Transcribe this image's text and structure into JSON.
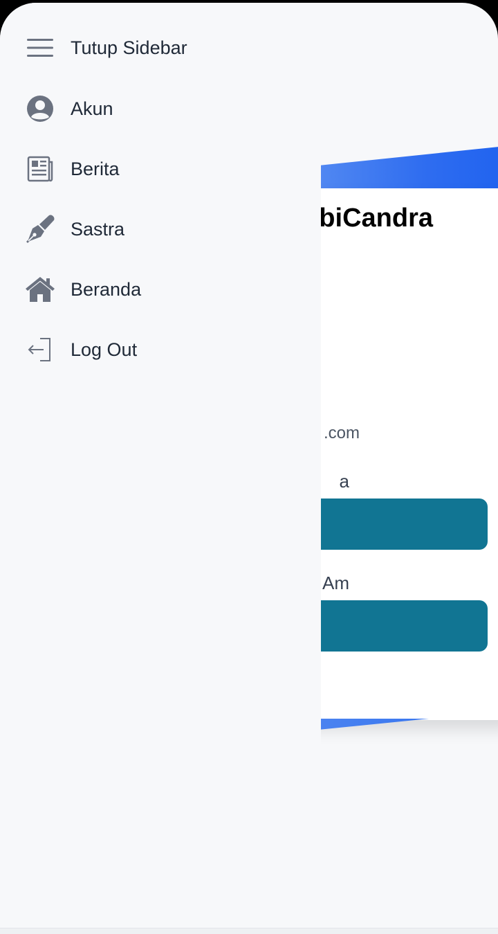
{
  "sidebar": {
    "items": [
      {
        "label": "Tutup Sidebar",
        "icon": "menu-icon"
      },
      {
        "label": "Akun",
        "icon": "user-circle-icon"
      },
      {
        "label": "Berita",
        "icon": "newspaper-icon"
      },
      {
        "label": "Sastra",
        "icon": "pen-nib-icon"
      },
      {
        "label": "Beranda",
        "icon": "home-icon"
      },
      {
        "label": "Log Out",
        "icon": "logout-icon"
      }
    ],
    "icon_color": "#6b7280"
  },
  "background": {
    "title_fragment": "biCandra",
    "email_fragment": ".com",
    "label1_fragment": "a",
    "label2_fragment": "Am",
    "button_color": "#117593",
    "accent_color": "#1f62ef"
  }
}
